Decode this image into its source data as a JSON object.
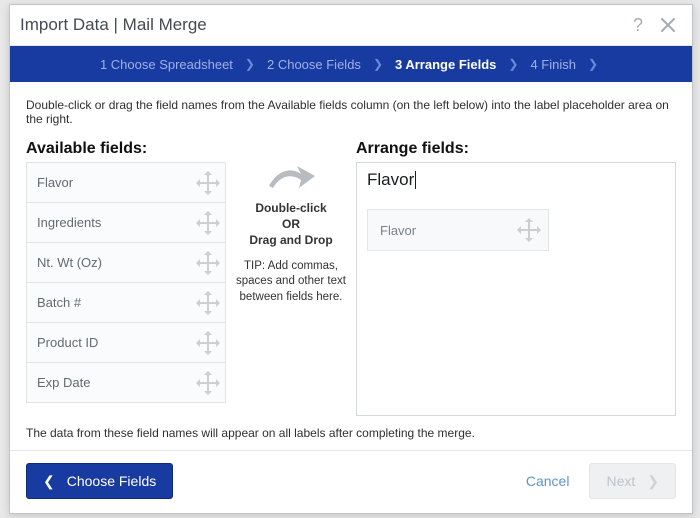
{
  "title": "Import Data | Mail Merge",
  "steps": {
    "s1": "1 Choose Spreadsheet",
    "s2": "2 Choose Fields",
    "s3": "3 Arrange Fields",
    "s4": "4 Finish"
  },
  "instructions": "Double-click or drag the field names from the Available fields column (on the left below) into the label placeholder area on the right.",
  "available_header": "Available fields:",
  "arrange_header": "Arrange fields:",
  "available_fields": {
    "f0": "Flavor",
    "f1": "Ingredients",
    "f2": "Nt. Wt (Oz)",
    "f3": "Batch #",
    "f4": "Product ID",
    "f5": "Exp Date"
  },
  "mid": {
    "strong_l1": "Double-click",
    "strong_l2": "OR",
    "strong_l3": "Drag and Drop",
    "tip": "TIP: Add commas, spaces and other text between fields here."
  },
  "arrange": {
    "typed_text": "Flavor",
    "chip_label": "Flavor"
  },
  "post_note": "The data from these field names will appear on all labels after completing the merge.",
  "footer": {
    "back_label": "Choose Fields",
    "cancel_label": "Cancel",
    "next_label": "Next"
  }
}
